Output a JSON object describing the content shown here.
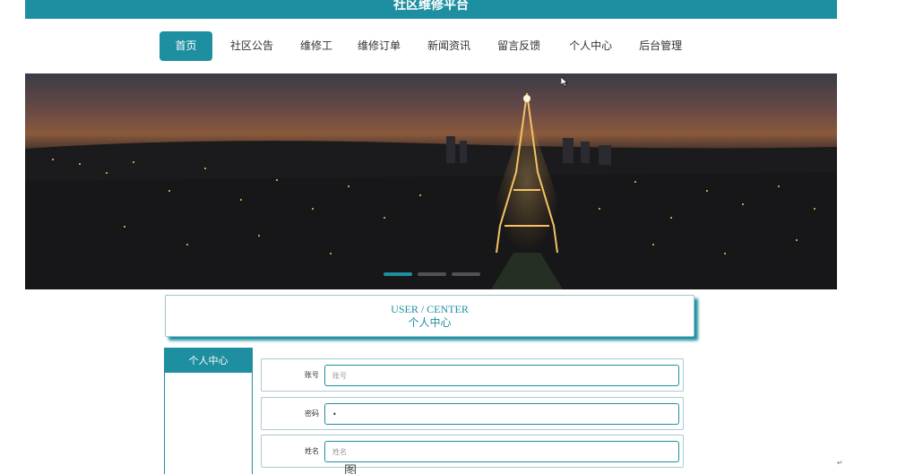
{
  "header": {
    "title": "社区维修平台"
  },
  "nav": {
    "items": [
      {
        "label": "首页",
        "active": true
      },
      {
        "label": "社区公告"
      },
      {
        "label": "维修工"
      },
      {
        "label": "维修订单"
      },
      {
        "label": "新闻资讯"
      },
      {
        "label": "留言反馈"
      },
      {
        "label": "个人中心"
      },
      {
        "label": "后台管理"
      }
    ]
  },
  "banner": {
    "description_icon": "city-night-photo",
    "active_slide": 1
  },
  "user_center": {
    "title_en": "USER / CENTER",
    "title_zh": "个人中心"
  },
  "sidebar": {
    "heading": "个人中心"
  },
  "form": {
    "account": {
      "label": "账号",
      "value": "",
      "placeholder": "账号"
    },
    "password": {
      "label": "密码",
      "value": "•"
    },
    "name": {
      "label": "姓名",
      "value": "",
      "placeholder": "姓名"
    }
  },
  "caption": {
    "text": "图"
  },
  "colors": {
    "accent": "#1e8fa0",
    "border": "#a9ccd3"
  }
}
